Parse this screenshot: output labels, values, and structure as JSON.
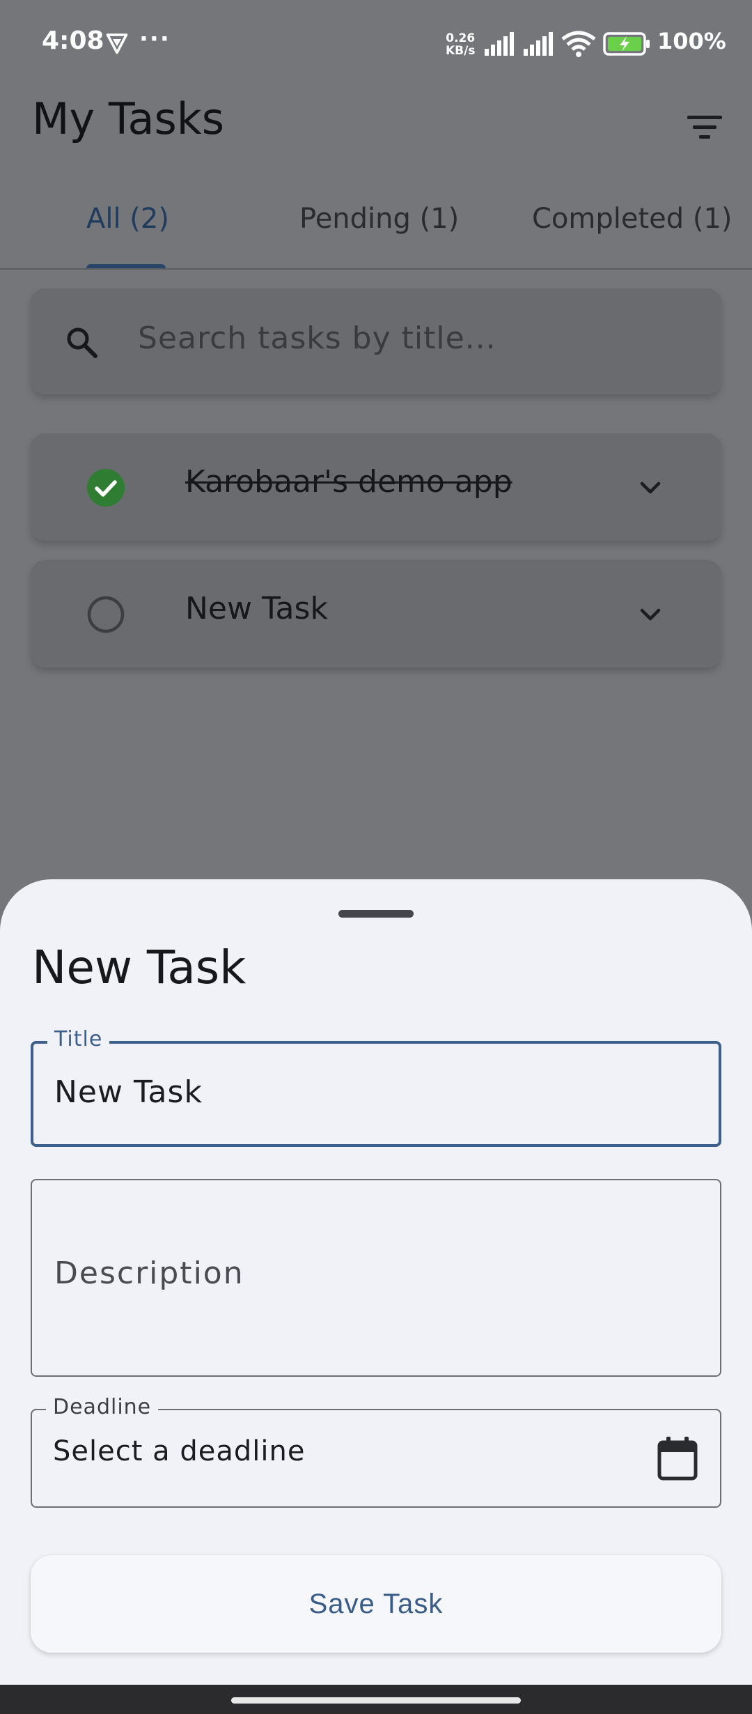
{
  "status_bar": {
    "time": "4:08",
    "dots": "···",
    "net_speed_value": "0.26",
    "net_speed_unit": "KB/s",
    "battery": "100%"
  },
  "app_bar": {
    "title": "My Tasks",
    "filter_icon": "filter-icon"
  },
  "tabs": [
    {
      "label": "All (2)",
      "selected": true
    },
    {
      "label": "Pending (1)",
      "selected": false
    },
    {
      "label": "Completed (1)",
      "selected": false
    }
  ],
  "search": {
    "placeholder": "Search tasks by title..."
  },
  "tasks": [
    {
      "title": "Karobaar's demo app",
      "completed": true
    },
    {
      "title": "New Task",
      "completed": false
    }
  ],
  "sheet": {
    "title": "New Task",
    "title_field": {
      "label": "Title",
      "value": "New Task"
    },
    "description_field": {
      "placeholder": "Description"
    },
    "deadline_field": {
      "label": "Deadline",
      "value": "Select a deadline"
    },
    "save_label": "Save Task"
  },
  "colors": {
    "primary": "#3c5f8d",
    "completed_green": "#2e7d32",
    "scrim": "#757679",
    "sheet_bg": "#f1f2f8"
  }
}
